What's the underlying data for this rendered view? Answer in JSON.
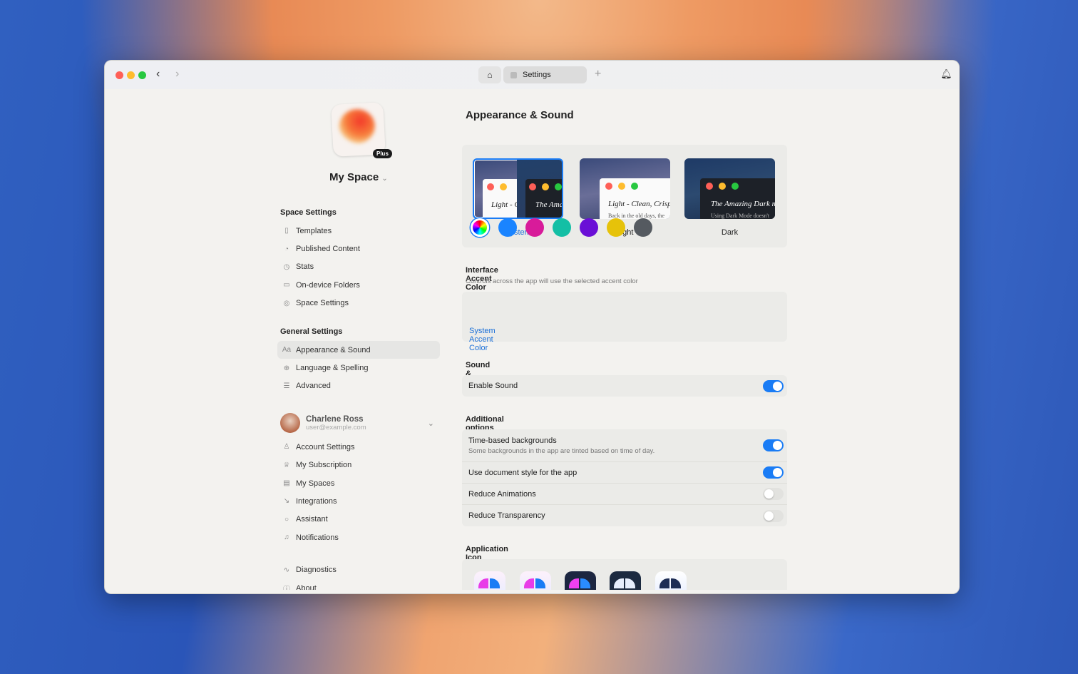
{
  "window": {
    "tab_label": "Settings",
    "home_icon": "home-icon",
    "new_tab": "+"
  },
  "space": {
    "name": "My Space",
    "badge": "Plus"
  },
  "sidebar": {
    "space_settings_header": "Space Settings",
    "space_items": [
      {
        "label": "Templates",
        "icon": "▯"
      },
      {
        "label": "Published Content",
        "icon": "◔"
      },
      {
        "label": "Stats",
        "icon": "◷"
      },
      {
        "label": "On-device Folders",
        "icon": "▭"
      },
      {
        "label": "Space Settings",
        "icon": "◎"
      }
    ],
    "general_header": "General Settings",
    "general_items": [
      {
        "label": "Appearance & Sound",
        "icon": "Aa"
      },
      {
        "label": "Language & Spelling",
        "icon": "⊕"
      },
      {
        "label": "Advanced",
        "icon": "☰"
      }
    ],
    "user": {
      "name": "Charlene Ross",
      "email": "user@example.com"
    },
    "account_items": [
      {
        "label": "Account Settings",
        "icon": "♙"
      },
      {
        "label": "My Subscription",
        "icon": "♕"
      },
      {
        "label": "My Spaces",
        "icon": "▤"
      },
      {
        "label": "Integrations",
        "icon": "↘"
      },
      {
        "label": "Assistant",
        "icon": "○"
      },
      {
        "label": "Notifications",
        "icon": "♫"
      }
    ],
    "bottom_items": [
      {
        "label": "Diagnostics",
        "icon": "∿"
      },
      {
        "label": "About",
        "icon": "ⓘ"
      }
    ]
  },
  "main": {
    "title": "Appearance & Sound",
    "themes": [
      {
        "label": "System",
        "preview_a": "Light - Clean, Crisp",
        "preview_b": "The Amazing Dark mode"
      },
      {
        "label": "Light",
        "preview": "Light - Clean, Crisp",
        "body": "Back in the old days, the"
      },
      {
        "label": "Dark",
        "preview": "The Amazing Dark mode",
        "body": "Using Dark Mode doesn't"
      }
    ],
    "selected_theme": "System",
    "accent": {
      "title": "Interface Accent Color",
      "subtitle": "Controls across the app will use the selected accent color",
      "selected_label": "System Accent Color",
      "colors": [
        "#1a84ff",
        "#d81b9a",
        "#14bfa5",
        "#6a0fd6",
        "#e6c20a",
        "#555a60"
      ]
    },
    "sound": {
      "title": "Sound & Haptics",
      "enable_sound": "Enable Sound",
      "enable_sound_on": true
    },
    "additional": {
      "title": "Additional options",
      "time_bg": "Time-based backgrounds",
      "time_bg_desc": "Some backgrounds in the app are tinted based on time of day.",
      "time_bg_on": true,
      "doc_style": "Use document style for the app",
      "doc_style_on": true,
      "reduce_anim": "Reduce Animations",
      "reduce_anim_on": false,
      "reduce_trans": "Reduce Transparency",
      "reduce_trans_on": false
    },
    "app_icon": {
      "title": "Application Icon"
    }
  },
  "colors": {
    "accent": "#1a7cf5"
  }
}
